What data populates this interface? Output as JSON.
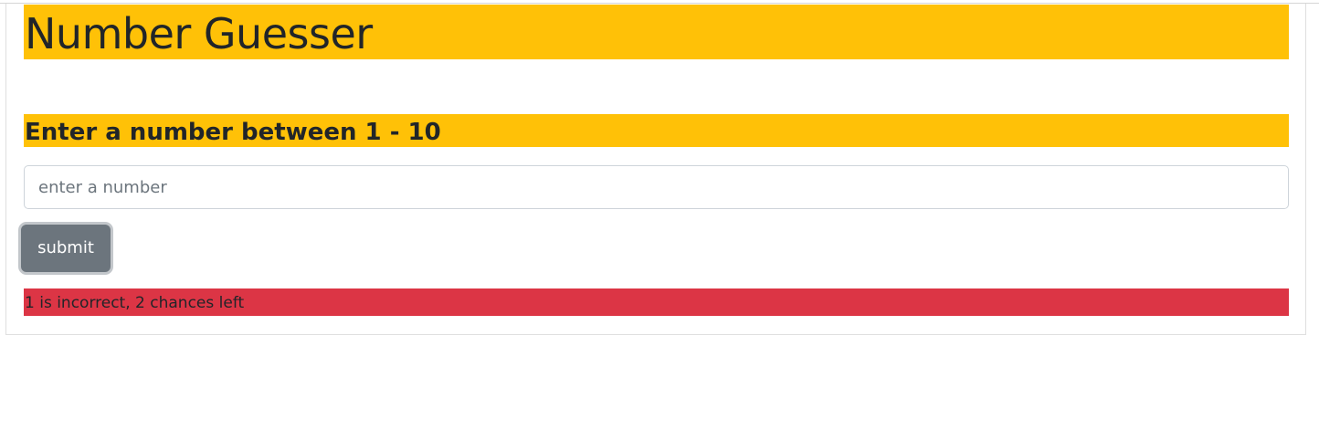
{
  "app": {
    "title": "Number Guesser"
  },
  "game": {
    "prompt": "Enter a number between 1 - 10",
    "input_placeholder": "enter a number",
    "input_value": "",
    "submit_label": "submit",
    "message": "1 is incorrect, 2 chances left"
  },
  "colors": {
    "header_bg": "#ffc107",
    "button_bg": "#6c757d",
    "message_bg": "#dc3545"
  }
}
